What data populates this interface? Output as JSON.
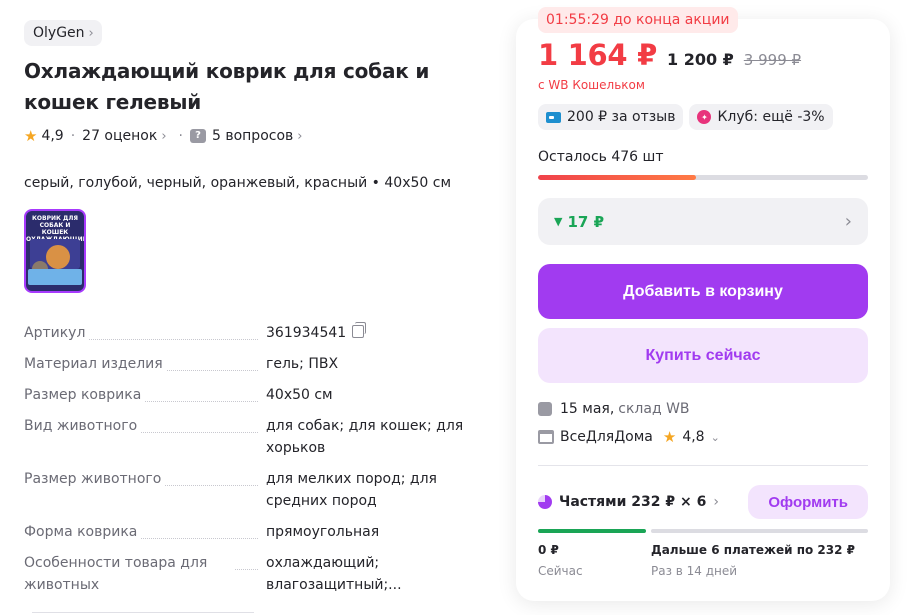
{
  "product": {
    "brand": "OlyGen",
    "title": "Охлаждающий коврик для собак и кошек гелевый",
    "rating": "4,9",
    "reviews": "27 оценок",
    "questions": "5 вопросов",
    "variants": "серый, голубой, черный, оранжевый, красный • 40x50 см",
    "thumb_text": "КОВРИК ДЛЯ СОБАК И КОШЕК ОХЛАЖДАЮЩИЙ"
  },
  "specs": [
    {
      "key": "Артикул",
      "value": "361934541"
    },
    {
      "key": "Материал изделия",
      "value": "гель; ПВХ"
    },
    {
      "key": "Размер коврика",
      "value": "40x50 см"
    },
    {
      "key": "Вид животного",
      "value": "для собак; для кошек; для хорьков"
    },
    {
      "key": "Размер животного",
      "value": "для мелких пород; для средних пород"
    },
    {
      "key": "Форма коврика",
      "value": "прямоугольная"
    },
    {
      "key": "Особенности товара для животных",
      "value": "охлаждающий; влагозащитный;..."
    }
  ],
  "offer": {
    "timer": "01:55:29 до конца акции",
    "price": "1 164 ₽",
    "price_no_wallet": "1 200 ₽",
    "price_old": "3 999 ₽",
    "wallet_note": "с WB Кошельком",
    "chip_review": "200 ₽ за отзыв",
    "chip_club": "Клуб: ещё -3%",
    "stock": "Осталось 476 шт",
    "stock_fraction": 0.48,
    "discount": "17 ₽",
    "add_to_cart": "Добавить в корзину",
    "buy_now": "Купить сейчас",
    "delivery_date": "15 мая,",
    "delivery_wh": "склад WB",
    "seller": "ВсеДляДома",
    "seller_rating": "4,8",
    "installments": "Частями 232 ₽ × 6",
    "installments_btn": "Оформить",
    "pay_now_amount": "0 ₽",
    "pay_now_label": "Сейчас",
    "pay_later_amount": "Дальше 6 платежей по 232 ₽",
    "pay_later_label": "Раз в 14 дней"
  },
  "colors": {
    "accent": "#a13bf0",
    "price_red": "#f23c44",
    "green": "#1aa556"
  }
}
